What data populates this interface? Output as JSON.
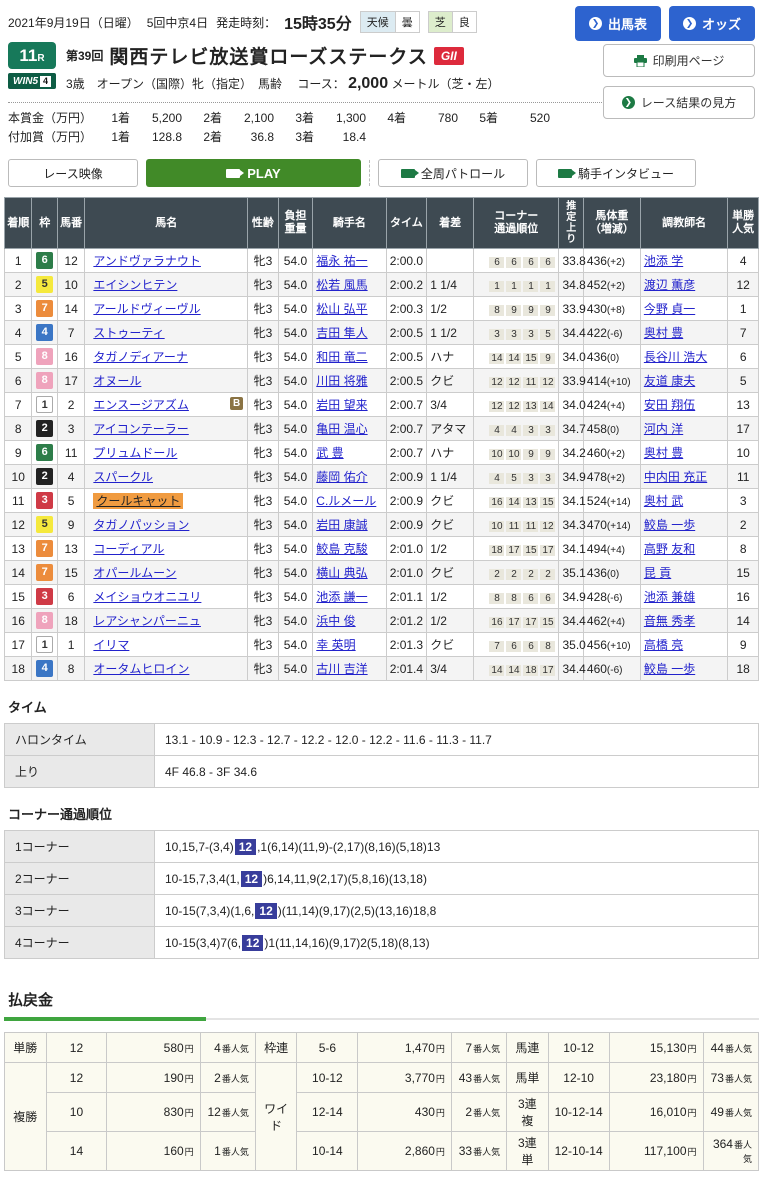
{
  "page": {
    "date_line": "2021年9月19日（日曜）",
    "meeting": "5回中京4日",
    "start_label": "発走時刻：",
    "start_time": "15時35分",
    "weather_label": "天候",
    "weather_value": "曇",
    "turf_label": "芝",
    "turf_value": "良"
  },
  "race": {
    "number": "11",
    "number_suffix": "R",
    "win5_text": "WIN5",
    "win5_num": "4",
    "edition": "第39回",
    "title": "関西テレビ放送賞ローズステークス",
    "grade": "GII",
    "conditions": "3歳　オープン（国際）牝（指定）　馬齢　",
    "course_label": "コース：",
    "course_distance": "2,000",
    "course_detail": "メートル（芝・左）"
  },
  "buttons": {
    "entry": "出馬表",
    "odds": "オッズ",
    "print": "印刷用ページ",
    "guide": "レース結果の見方",
    "race_video": "レース映像",
    "play": "PLAY",
    "patrol": "全周パトロール",
    "interview": "騎手インタビュー"
  },
  "prize": {
    "main_label": "本賞金（万円）",
    "main": [
      {
        "rank": "1着",
        "value": "5,200"
      },
      {
        "rank": "2着",
        "value": "2,100"
      },
      {
        "rank": "3着",
        "value": "1,300"
      },
      {
        "rank": "4着",
        "value": "780"
      },
      {
        "rank": "5着",
        "value": "520"
      }
    ],
    "extra_label": "付加賞（万円）",
    "extra": [
      {
        "rank": "1着",
        "value": "128.8"
      },
      {
        "rank": "2着",
        "value": "36.8"
      },
      {
        "rank": "3着",
        "value": "18.4"
      }
    ]
  },
  "colors": {
    "accent_green": "#3fa53f",
    "button_blue": "#2d63cf",
    "play_green": "#418a28",
    "grade_red": "#dd2a3c",
    "header_slate": "#3e4a52",
    "link_blue": "#2222cc",
    "horse_highlight_orange": "#f09b40",
    "corner_highlight_indigo": "#383d9b",
    "race_badge_green": "#17795a"
  },
  "frame_colors": {
    "1": {
      "bg": "#ffffff",
      "fg": "#333333",
      "border": "#aaaaaa"
    },
    "2": {
      "bg": "#222222",
      "fg": "#ffffff"
    },
    "3": {
      "bg": "#cf3a46",
      "fg": "#ffffff"
    },
    "4": {
      "bg": "#3b76c5",
      "fg": "#ffffff"
    },
    "5": {
      "bg": "#f5e93d",
      "fg": "#333333"
    },
    "6": {
      "bg": "#2d7d49",
      "fg": "#ffffff"
    },
    "7": {
      "bg": "#ec8c3c",
      "fg": "#ffffff"
    },
    "8": {
      "bg": "#efa3bc",
      "fg": "#ffffff"
    }
  },
  "results": {
    "headers": [
      "着順",
      "枠",
      "馬番",
      "馬名",
      "性齢",
      "負担\n重量",
      "騎手名",
      "タイム",
      "着差",
      "コーナー\n通過順位",
      "推定上り",
      "馬体重\n（増減）",
      "調教師名",
      "単勝\n人気"
    ],
    "rows": [
      {
        "pos": "1",
        "frame": "6",
        "num": "12",
        "horse": "アンドヴァラナウト",
        "hl": false,
        "b": false,
        "sex": "牝3",
        "wt": "54.0",
        "jockey": "福永 祐一",
        "time": "2:00.0",
        "margin": "",
        "corners": [
          "6",
          "6",
          "6",
          "6"
        ],
        "up": "33.8",
        "bw": "436",
        "bwd": "(+2)",
        "trainer": "池添 学",
        "pop": "4"
      },
      {
        "pos": "2",
        "frame": "5",
        "num": "10",
        "horse": "エイシンヒテン",
        "hl": false,
        "b": false,
        "sex": "牝3",
        "wt": "54.0",
        "jockey": "松若 風馬",
        "time": "2:00.2",
        "margin": "1 1/4",
        "corners": [
          "1",
          "1",
          "1",
          "1"
        ],
        "up": "34.8",
        "bw": "452",
        "bwd": "(+2)",
        "trainer": "渡辺 薫彦",
        "pop": "12"
      },
      {
        "pos": "3",
        "frame": "7",
        "num": "14",
        "horse": "アールドヴィーヴル",
        "hl": false,
        "b": false,
        "sex": "牝3",
        "wt": "54.0",
        "jockey": "松山 弘平",
        "time": "2:00.3",
        "margin": "1/2",
        "corners": [
          "8",
          "9",
          "9",
          "9"
        ],
        "up": "33.9",
        "bw": "430",
        "bwd": "(+8)",
        "trainer": "今野 貞一",
        "pop": "1"
      },
      {
        "pos": "4",
        "frame": "4",
        "num": "7",
        "horse": "ストゥーティ",
        "hl": false,
        "b": false,
        "sex": "牝3",
        "wt": "54.0",
        "jockey": "吉田 隼人",
        "time": "2:00.5",
        "margin": "1 1/2",
        "corners": [
          "3",
          "3",
          "3",
          "5"
        ],
        "up": "34.4",
        "bw": "422",
        "bwd": "(-6)",
        "trainer": "奥村 豊",
        "pop": "7"
      },
      {
        "pos": "5",
        "frame": "8",
        "num": "16",
        "horse": "タガノディアーナ",
        "hl": false,
        "b": false,
        "sex": "牝3",
        "wt": "54.0",
        "jockey": "和田 竜二",
        "time": "2:00.5",
        "margin": "ハナ",
        "corners": [
          "14",
          "14",
          "15",
          "9"
        ],
        "up": "34.0",
        "bw": "436",
        "bwd": "(0)",
        "trainer": "長谷川 浩大",
        "pop": "6"
      },
      {
        "pos": "6",
        "frame": "8",
        "num": "17",
        "horse": "オヌール",
        "hl": false,
        "b": false,
        "sex": "牝3",
        "wt": "54.0",
        "jockey": "川田 将雅",
        "time": "2:00.5",
        "margin": "クビ",
        "corners": [
          "12",
          "12",
          "11",
          "12"
        ],
        "up": "33.9",
        "bw": "414",
        "bwd": "(+10)",
        "trainer": "友道 康夫",
        "pop": "5"
      },
      {
        "pos": "7",
        "frame": "1",
        "num": "2",
        "horse": "エンスージアズム",
        "hl": false,
        "b": true,
        "sex": "牝3",
        "wt": "54.0",
        "jockey": "岩田 望来",
        "time": "2:00.7",
        "margin": "3/4",
        "corners": [
          "12",
          "12",
          "13",
          "14"
        ],
        "up": "34.0",
        "bw": "424",
        "bwd": "(+4)",
        "trainer": "安田 翔伍",
        "pop": "13"
      },
      {
        "pos": "8",
        "frame": "2",
        "num": "3",
        "horse": "アイコンテーラー",
        "hl": false,
        "b": false,
        "sex": "牝3",
        "wt": "54.0",
        "jockey": "亀田 温心",
        "time": "2:00.7",
        "margin": "アタマ",
        "corners": [
          "4",
          "4",
          "3",
          "3"
        ],
        "up": "34.7",
        "bw": "458",
        "bwd": "(0)",
        "trainer": "河内 洋",
        "pop": "17"
      },
      {
        "pos": "9",
        "frame": "6",
        "num": "11",
        "horse": "プリュムドール",
        "hl": false,
        "b": false,
        "sex": "牝3",
        "wt": "54.0",
        "jockey": "武 豊",
        "time": "2:00.7",
        "margin": "ハナ",
        "corners": [
          "10",
          "10",
          "9",
          "9"
        ],
        "up": "34.2",
        "bw": "460",
        "bwd": "(+2)",
        "trainer": "奥村 豊",
        "pop": "10"
      },
      {
        "pos": "10",
        "frame": "2",
        "num": "4",
        "horse": "スパークル",
        "hl": false,
        "b": false,
        "sex": "牝3",
        "wt": "54.0",
        "jockey": "藤岡 佑介",
        "time": "2:00.9",
        "margin": "1 1/4",
        "corners": [
          "4",
          "5",
          "3",
          "3"
        ],
        "up": "34.9",
        "bw": "478",
        "bwd": "(+2)",
        "trainer": "中内田 充正",
        "pop": "11"
      },
      {
        "pos": "11",
        "frame": "3",
        "num": "5",
        "horse": "クールキャット",
        "hl": true,
        "b": false,
        "sex": "牝3",
        "wt": "54.0",
        "jockey": "C.ルメール",
        "time": "2:00.9",
        "margin": "クビ",
        "corners": [
          "16",
          "14",
          "13",
          "15"
        ],
        "up": "34.1",
        "bw": "524",
        "bwd": "(+14)",
        "trainer": "奥村 武",
        "pop": "3"
      },
      {
        "pos": "12",
        "frame": "5",
        "num": "9",
        "horse": "タガノパッション",
        "hl": false,
        "b": false,
        "sex": "牝3",
        "wt": "54.0",
        "jockey": "岩田 康誠",
        "time": "2:00.9",
        "margin": "クビ",
        "corners": [
          "10",
          "11",
          "11",
          "12"
        ],
        "up": "34.3",
        "bw": "470",
        "bwd": "(+14)",
        "trainer": "鮫島 一歩",
        "pop": "2"
      },
      {
        "pos": "13",
        "frame": "7",
        "num": "13",
        "horse": "コーディアル",
        "hl": false,
        "b": false,
        "sex": "牝3",
        "wt": "54.0",
        "jockey": "鮫島 克駿",
        "time": "2:01.0",
        "margin": "1/2",
        "corners": [
          "18",
          "17",
          "15",
          "17"
        ],
        "up": "34.1",
        "bw": "494",
        "bwd": "(+4)",
        "trainer": "高野 友和",
        "pop": "8"
      },
      {
        "pos": "14",
        "frame": "7",
        "num": "15",
        "horse": "オパールムーン",
        "hl": false,
        "b": false,
        "sex": "牝3",
        "wt": "54.0",
        "jockey": "横山 典弘",
        "time": "2:01.0",
        "margin": "クビ",
        "corners": [
          "2",
          "2",
          "2",
          "2"
        ],
        "up": "35.1",
        "bw": "436",
        "bwd": "(0)",
        "trainer": "昆 貢",
        "pop": "15"
      },
      {
        "pos": "15",
        "frame": "3",
        "num": "6",
        "horse": "メイショウオニユリ",
        "hl": false,
        "b": false,
        "sex": "牝3",
        "wt": "54.0",
        "jockey": "池添 謙一",
        "time": "2:01.1",
        "margin": "1/2",
        "corners": [
          "8",
          "8",
          "6",
          "6"
        ],
        "up": "34.9",
        "bw": "428",
        "bwd": "(-6)",
        "trainer": "池添 兼雄",
        "pop": "16"
      },
      {
        "pos": "16",
        "frame": "8",
        "num": "18",
        "horse": "レアシャンパーニュ",
        "hl": false,
        "b": false,
        "sex": "牝3",
        "wt": "54.0",
        "jockey": "浜中 俊",
        "time": "2:01.2",
        "margin": "1/2",
        "corners": [
          "16",
          "17",
          "17",
          "15"
        ],
        "up": "34.4",
        "bw": "462",
        "bwd": "(+4)",
        "trainer": "音無 秀孝",
        "pop": "14"
      },
      {
        "pos": "17",
        "frame": "1",
        "num": "1",
        "horse": "イリマ",
        "hl": false,
        "b": false,
        "sex": "牝3",
        "wt": "54.0",
        "jockey": "幸 英明",
        "time": "2:01.3",
        "margin": "クビ",
        "corners": [
          "7",
          "6",
          "6",
          "8"
        ],
        "up": "35.0",
        "bw": "456",
        "bwd": "(+10)",
        "trainer": "高橋 亮",
        "pop": "9"
      },
      {
        "pos": "18",
        "frame": "4",
        "num": "8",
        "horse": "オータムヒロイン",
        "hl": false,
        "b": false,
        "sex": "牝3",
        "wt": "54.0",
        "jockey": "古川 吉洋",
        "time": "2:01.4",
        "margin": "3/4",
        "corners": [
          "14",
          "14",
          "18",
          "17"
        ],
        "up": "34.4",
        "bw": "460",
        "bwd": "(-6)",
        "trainer": "鮫島 一歩",
        "pop": "18"
      }
    ]
  },
  "time_section": {
    "title": "タイム",
    "rows": [
      {
        "label": "ハロンタイム",
        "value": "13.1 - 10.9 - 12.3 - 12.7 - 12.2 - 12.0 - 12.2 - 11.6 - 11.3 - 11.7"
      },
      {
        "label": "上り",
        "value": "4F 46.8 - 3F 34.6"
      }
    ]
  },
  "corner_section": {
    "title": "コーナー通過順位",
    "rows": [
      {
        "label": "1コーナー",
        "pre": "10,15,7-(3,4)",
        "hl": "12",
        "post": ",1(6,14)(11,9)-(2,17)(8,16)(5,18)13"
      },
      {
        "label": "2コーナー",
        "pre": "10-15,7,3,4(1,",
        "hl": "12",
        "post": ")6,14,11,9(2,17)(5,8,16)(13,18)"
      },
      {
        "label": "3コーナー",
        "pre": "10-15(7,3,4)(1,6,",
        "hl": "12",
        "post": ")(11,14)(9,17)(2,5)(13,16)18,8"
      },
      {
        "label": "4コーナー",
        "pre": "10-15(3,4)7(6,",
        "hl": "12",
        "post": ")1(11,14,16)(9,17)2(5,18)(8,13)"
      }
    ]
  },
  "payout": {
    "title": "払戻金",
    "yen_unit": "円",
    "pop_unit": "番人気",
    "groups": [
      [
        {
          "label": "単勝",
          "rows": [
            [
              "12",
              "580",
              "4"
            ]
          ]
        },
        {
          "label": "複勝",
          "rows": [
            [
              "12",
              "190",
              "2"
            ],
            [
              "10",
              "830",
              "12"
            ],
            [
              "14",
              "160",
              "1"
            ]
          ]
        }
      ],
      [
        {
          "label": "枠連",
          "rows": [
            [
              "5-6",
              "1,470",
              "7"
            ]
          ]
        },
        {
          "label": "ワイド",
          "rows": [
            [
              "10-12",
              "3,770",
              "43"
            ],
            [
              "12-14",
              "430",
              "2"
            ],
            [
              "10-14",
              "2,860",
              "33"
            ]
          ]
        }
      ],
      [
        {
          "label": "馬連",
          "rows": [
            [
              "10-12",
              "15,130",
              "44"
            ]
          ]
        },
        {
          "label": "馬単",
          "rows": [
            [
              "12-10",
              "23,180",
              "73"
            ]
          ]
        },
        {
          "label": "3連複",
          "rows": [
            [
              "10-12-14",
              "16,010",
              "49"
            ]
          ]
        },
        {
          "label": "3連単",
          "rows": [
            [
              "12-10-14",
              "117,100",
              "364"
            ]
          ]
        }
      ]
    ]
  }
}
